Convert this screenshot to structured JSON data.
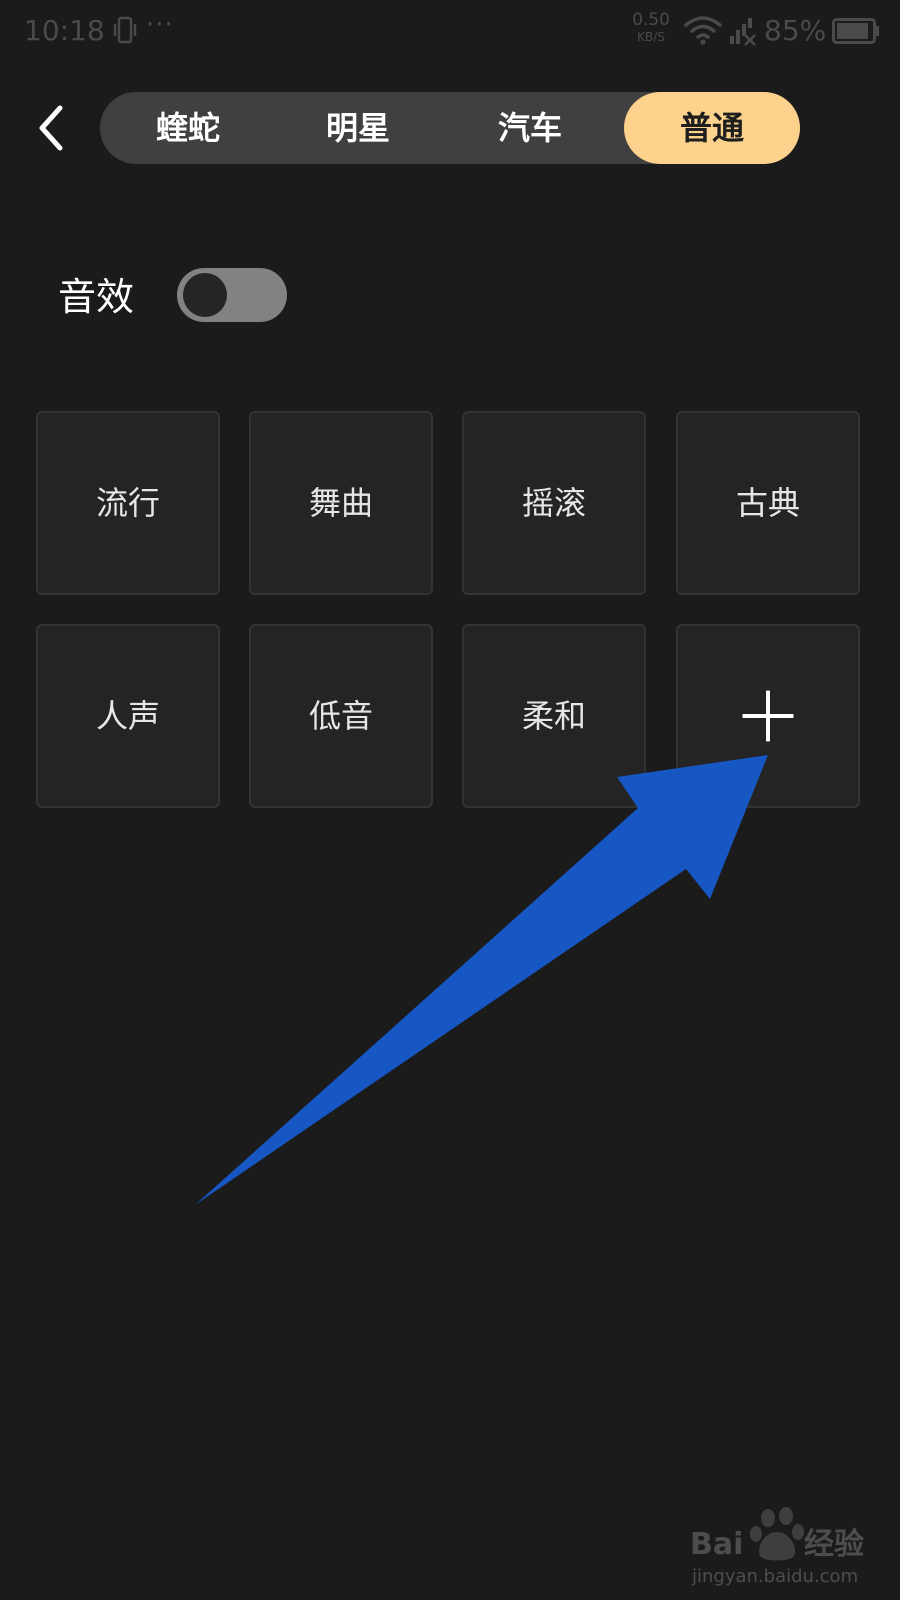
{
  "status_bar": {
    "time": "10:18",
    "menu_dots": "···",
    "net_speed_value": "0.50",
    "net_speed_unit": "KB/S",
    "battery": "85%"
  },
  "segment": {
    "tabs": [
      {
        "label": "蝰蛇"
      },
      {
        "label": "明星"
      },
      {
        "label": "汽车"
      },
      {
        "label": "普通"
      }
    ],
    "selected_index": 3
  },
  "sound_effect": {
    "label": "音效",
    "enabled": false
  },
  "presets": [
    {
      "label": "流行"
    },
    {
      "label": "舞曲"
    },
    {
      "label": "摇滚"
    },
    {
      "label": "古典"
    },
    {
      "label": "人声"
    },
    {
      "label": "低音"
    },
    {
      "label": "柔和"
    }
  ],
  "icons": {
    "back": "chevron-left-icon",
    "add": "plus-icon"
  },
  "colors": {
    "background": "#1b1b1b",
    "active_tab": "#fcd28d",
    "segment_bg": "#404040",
    "tile_bg": "#242424",
    "annotation_arrow": "#1657c4"
  },
  "watermark": {
    "text": "Baidu经验",
    "url": "jingyan.baidu.com"
  }
}
